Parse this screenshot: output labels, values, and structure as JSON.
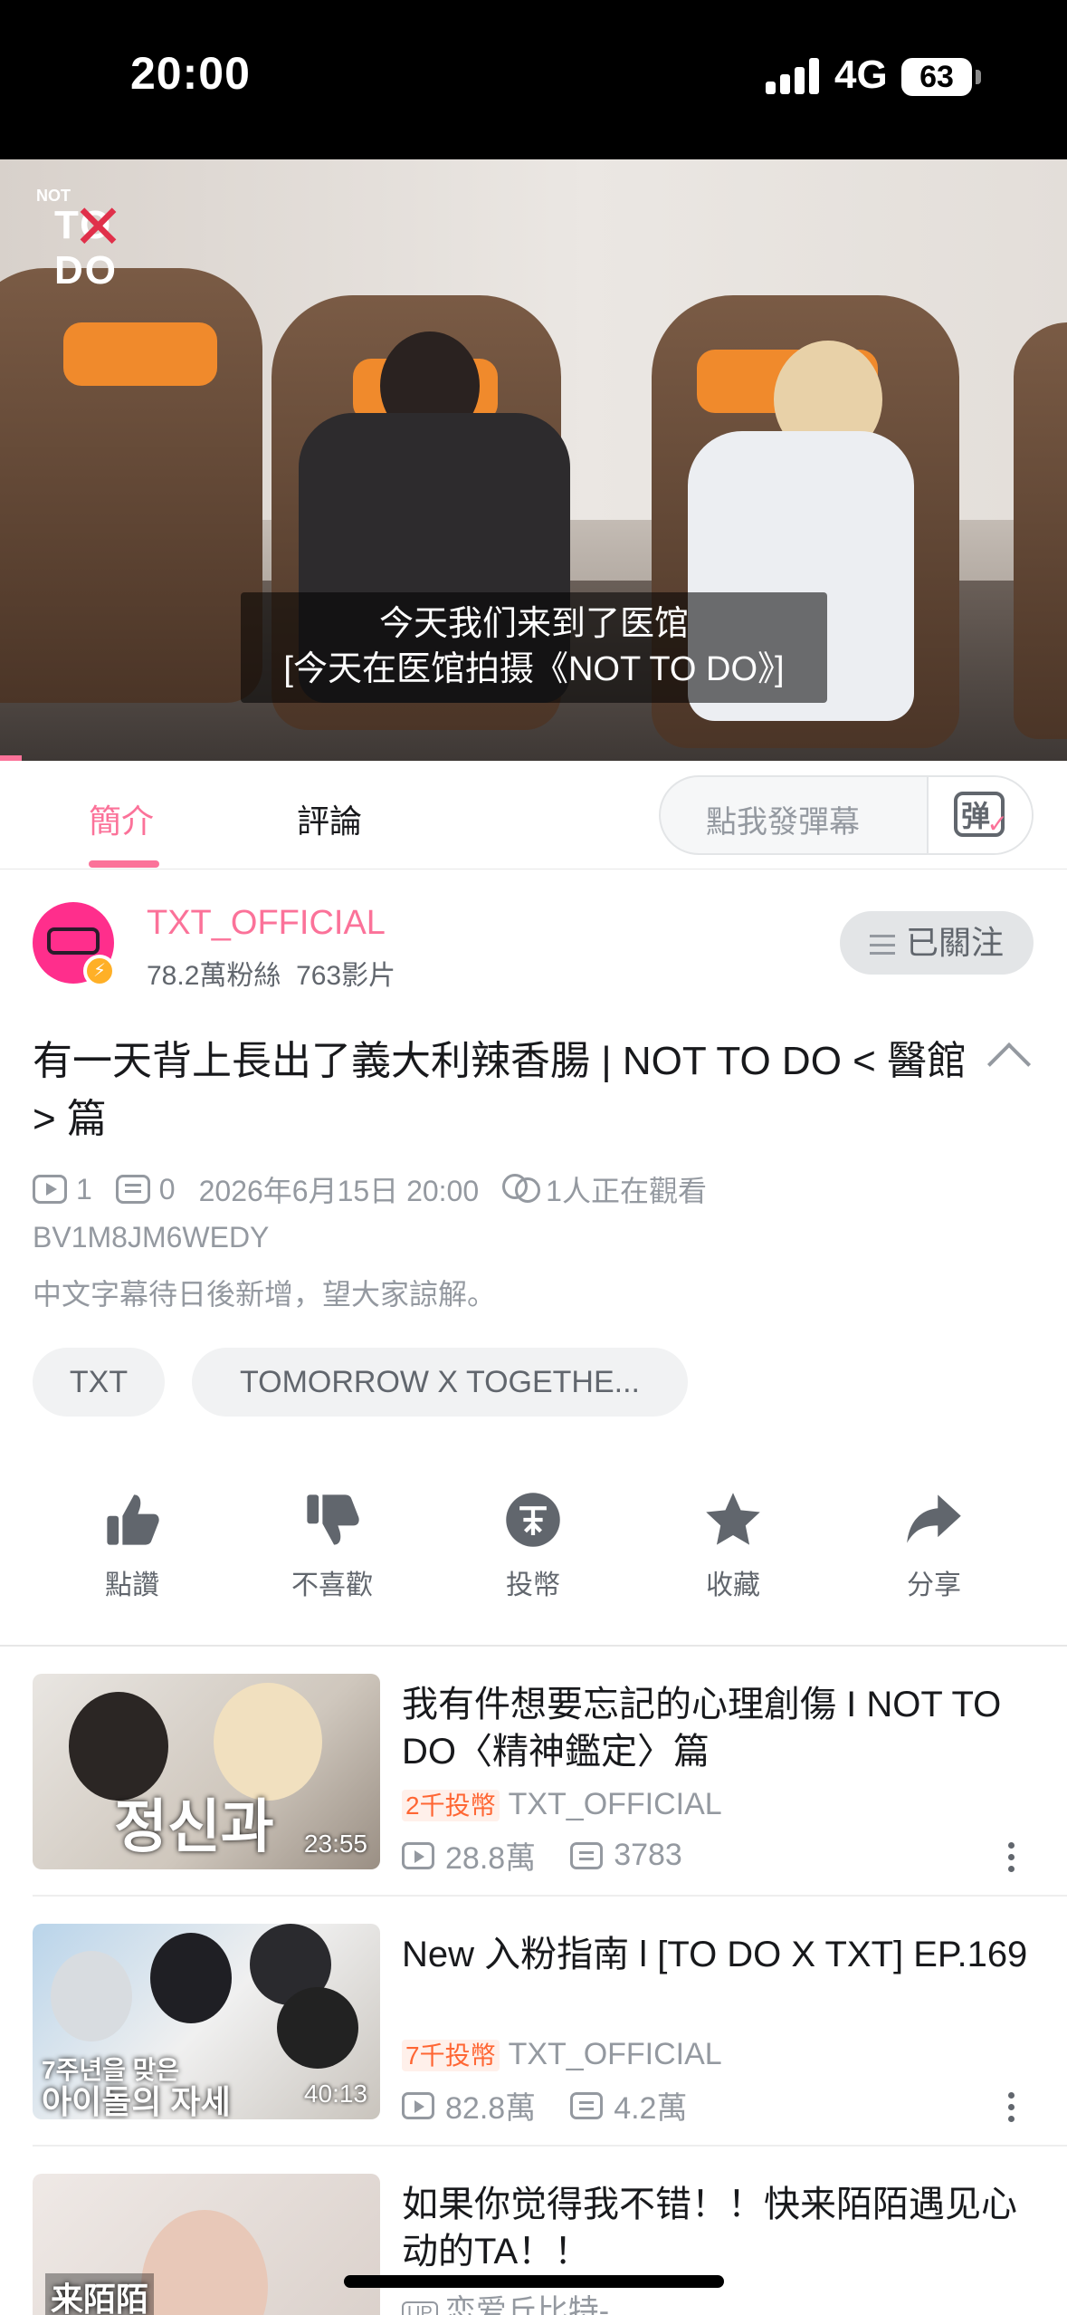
{
  "status_bar": {
    "time": "20:00",
    "network": "4G",
    "battery": "63"
  },
  "player": {
    "logo": {
      "small": "NOT",
      "big": "TO DO"
    },
    "subtitle_line1": "今天我们来到了医馆",
    "subtitle_line2": "[今天在医馆拍摄《NOT TO DO》]",
    "progress": 0.02
  },
  "tabs": {
    "intro": "簡介",
    "comments": "評論",
    "danmaku_placeholder": "點我發彈幕",
    "danmaku_icon_char": "弹"
  },
  "uploader": {
    "name": "TXT_OFFICIAL",
    "followers": "78.2萬粉絲",
    "videos": "763影片",
    "follow_label": "已關注"
  },
  "video": {
    "title": "有一天背上長出了義大利辣香腸 | NOT TO DO < 醫館> 篇",
    "views": "1",
    "danmaku_count": "0",
    "date": "2026年6月15日 20:00",
    "watching": "1人正在觀看",
    "bvid": "BV1M8JM6WEDY",
    "description": "中文字幕待日後新增，望大家諒解。",
    "tags": [
      "TXT",
      "TOMORROW X TOGETHE..."
    ]
  },
  "actions": [
    {
      "label": "點讚",
      "icon": "thumb-up-icon"
    },
    {
      "label": "不喜歡",
      "icon": "thumb-down-icon"
    },
    {
      "label": "投幣",
      "icon": "coin-icon"
    },
    {
      "label": "收藏",
      "icon": "star-icon"
    },
    {
      "label": "分享",
      "icon": "share-icon"
    }
  ],
  "related": [
    {
      "title": "我有件想要忘記的心理創傷 I NOT TO DO〈精神鑑定〉篇",
      "coin": "2千投幣",
      "uploader": "TXT_OFFICIAL",
      "views": "28.8萬",
      "danmaku": "3783",
      "duration": "23:55",
      "thumb_text": "정신과"
    },
    {
      "title": "New 入粉指南 l [TO DO X TXT] EP.169",
      "coin": "7千投幣",
      "uploader": "TXT_OFFICIAL",
      "views": "82.8萬",
      "danmaku": "4.2萬",
      "duration": "40:13",
      "thumb_text1": "7주년을 맞은",
      "thumb_text2": "아이돌의 자세"
    },
    {
      "title": "如果你觉得我不错！！快来陌陌遇见心动的TA！！",
      "uploader": "恋爱丘比特-",
      "up_badge": "UP",
      "thumb_text": "来陌陌"
    }
  ],
  "colors": {
    "accent": "#fb7299",
    "coin": "#ff6633",
    "muted": "#9499a0"
  }
}
